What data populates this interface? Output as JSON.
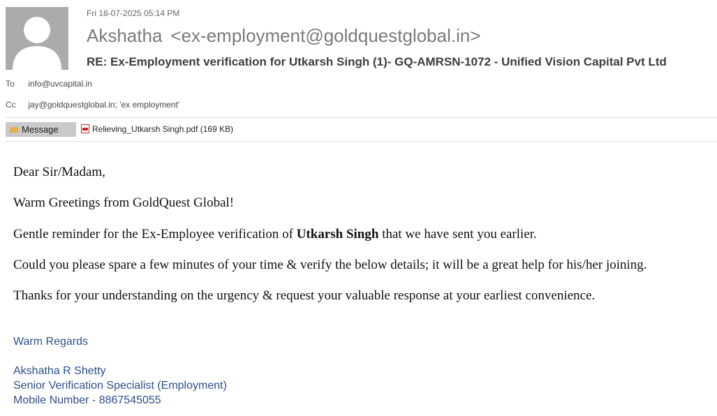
{
  "header": {
    "datetime": "Fri 18-07-2025 05:14 PM",
    "sender_name": "Akshatha",
    "sender_email": "<ex-employment@goldquestglobal.in>",
    "subject": "RE: Ex-Employment verification for Utkarsh Singh (1)- GQ-AMRSN-1072 - Unified Vision Capital Pvt Ltd",
    "to_label": "To",
    "to_value": "info@uvcapital.in",
    "cc_label": "Cc",
    "cc_value": "jay@goldquestglobal.in; 'ex employment'"
  },
  "tabs": {
    "message_label": "Message",
    "attachment_label": "Relieving_Utkarsh Singh.pdf (169 KB)"
  },
  "body": {
    "greeting": "Dear Sir/Madam,",
    "line1": "Warm Greetings from GoldQuest Global!",
    "line2_pre": "Gentle reminder for the Ex-Employee verification of ",
    "line2_bold": "Utkarsh Singh",
    "line2_post": " that we have sent you earlier.",
    "line3": "Could you please spare a few minutes of your time & verify the below details; it will be a great help for his/her joining.",
    "line4": "Thanks for your understanding on the urgency & request your valuable response at your earliest convenience."
  },
  "signature": {
    "regards": "Warm Regards",
    "name": "Akshatha R Shetty",
    "title": "Senior Verification Specialist (Employment)",
    "mobile": "Mobile Number - 8867545055"
  },
  "colors": {
    "signature": "#2e4f8c",
    "message_tab_bg": "#c9c9c9",
    "avatar_bg": "#a9abad"
  },
  "icons": {
    "avatar": "user-silhouette-icon",
    "message_tab": "envelope-icon",
    "attachment": "pdf-file-icon"
  }
}
